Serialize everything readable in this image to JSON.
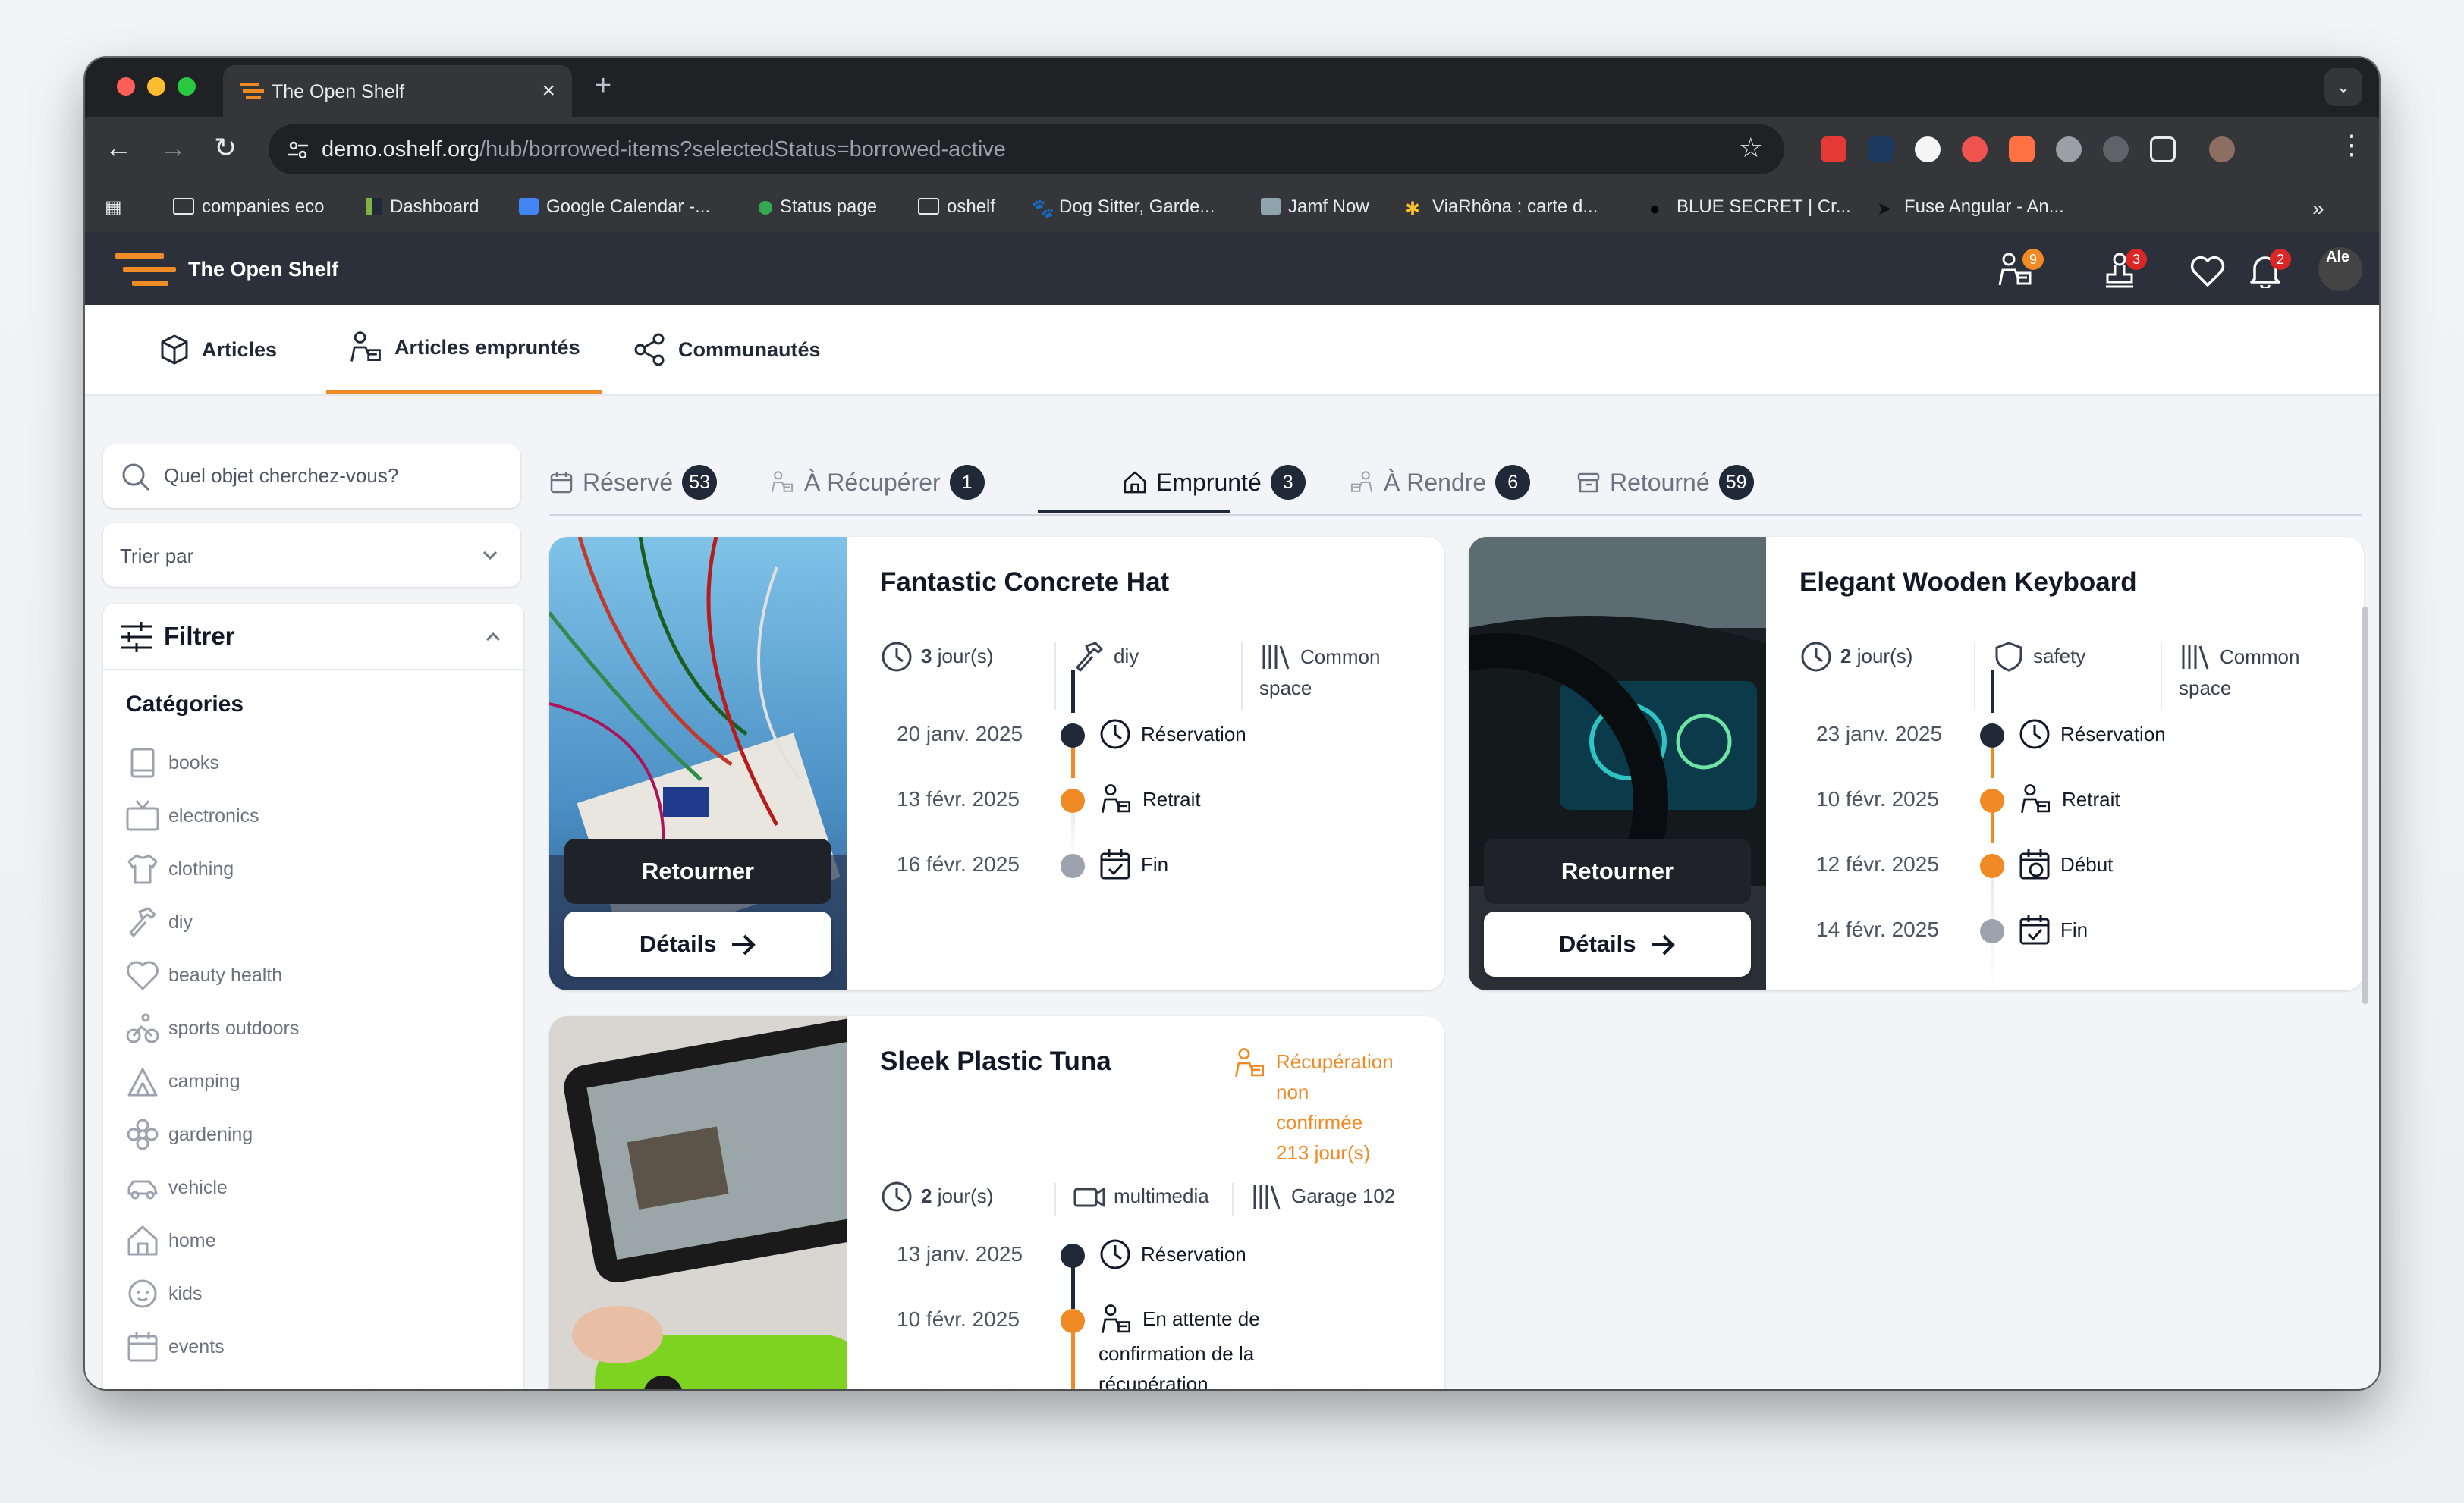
{
  "browser": {
    "tab_title": "The Open Shelf",
    "url_host": "demo.oshelf.org",
    "url_path": "/hub/borrowed-items?selectedStatus=borrowed-active",
    "bookmarks": [
      "companies eco",
      "Dashboard",
      "Google Calendar -...",
      "Status page",
      "oshelf",
      "Dog Sitter, Garde...",
      "Jamf Now",
      "ViaRhôna : carte d...",
      "BLUE SECRET | Cr...",
      "Fuse Angular - An..."
    ]
  },
  "header": {
    "brand": "The Open Shelf",
    "badges": {
      "borrowed": "9",
      "lent": "3",
      "notifications": "2"
    },
    "avatar_text": "Ale"
  },
  "nav": {
    "tabs": [
      "Articles",
      "Articles empruntés",
      "Communautés"
    ]
  },
  "sidebar": {
    "search_placeholder": "Quel objet cherchez-vous?",
    "sort_label": "Trier par",
    "filter_title": "Filtrer",
    "categories_title": "Catégories",
    "categories": [
      "books",
      "electronics",
      "clothing",
      "diy",
      "beauty health",
      "sports outdoors",
      "camping",
      "gardening",
      "vehicle",
      "home",
      "kids",
      "events"
    ]
  },
  "status_tabs": [
    {
      "label": "Réservé",
      "count": "53"
    },
    {
      "label": "À Récupérer",
      "count": "1"
    },
    {
      "label": "Emprunté",
      "count": "3"
    },
    {
      "label": "À Rendre",
      "count": "6"
    },
    {
      "label": "Retourné",
      "count": "59"
    }
  ],
  "cards": [
    {
      "title": "Fantastic Concrete Hat",
      "duration_num": "3",
      "duration_unit": "jour(s)",
      "category": "diy",
      "location_line1": "Common",
      "location_line2": "space",
      "timeline": [
        {
          "date": "20 janv. 2025",
          "label": "Réservation"
        },
        {
          "date": "13 févr. 2025",
          "label": "Retrait"
        },
        {
          "date": "16 févr. 2025",
          "label": "Fin"
        }
      ],
      "return_btn": "Retourner",
      "details_btn": "Détails"
    },
    {
      "title": "Elegant Wooden Keyboard",
      "duration_num": "2",
      "duration_unit": "jour(s)",
      "category": "safety",
      "location_line1": "Common",
      "location_line2": "space",
      "timeline": [
        {
          "date": "23 janv. 2025",
          "label": "Réservation"
        },
        {
          "date": "10 févr. 2025",
          "label": "Retrait"
        },
        {
          "date": "12 févr. 2025",
          "label": "Début"
        },
        {
          "date": "14 févr. 2025",
          "label": "Fin"
        }
      ],
      "return_btn": "Retourner",
      "details_btn": "Détails"
    },
    {
      "title": "Sleek Plastic Tuna",
      "warning": [
        "Récupération",
        "non",
        "confirmée",
        "213 jour(s)"
      ],
      "duration_num": "2",
      "duration_unit": "jour(s)",
      "category": "multimedia",
      "location_line1": "Garage 102",
      "timeline": [
        {
          "date": "13 janv. 2025",
          "label": "Réservation"
        },
        {
          "date": "10 févr. 2025",
          "label_lines": [
            "En attente de",
            "confirmation de la",
            "récupération"
          ]
        }
      ]
    }
  ],
  "colors": {
    "accent": "#f08a24",
    "dark": "#1f2937",
    "header_bg": "#2b303b",
    "gray_dot": "#9ca3af"
  }
}
